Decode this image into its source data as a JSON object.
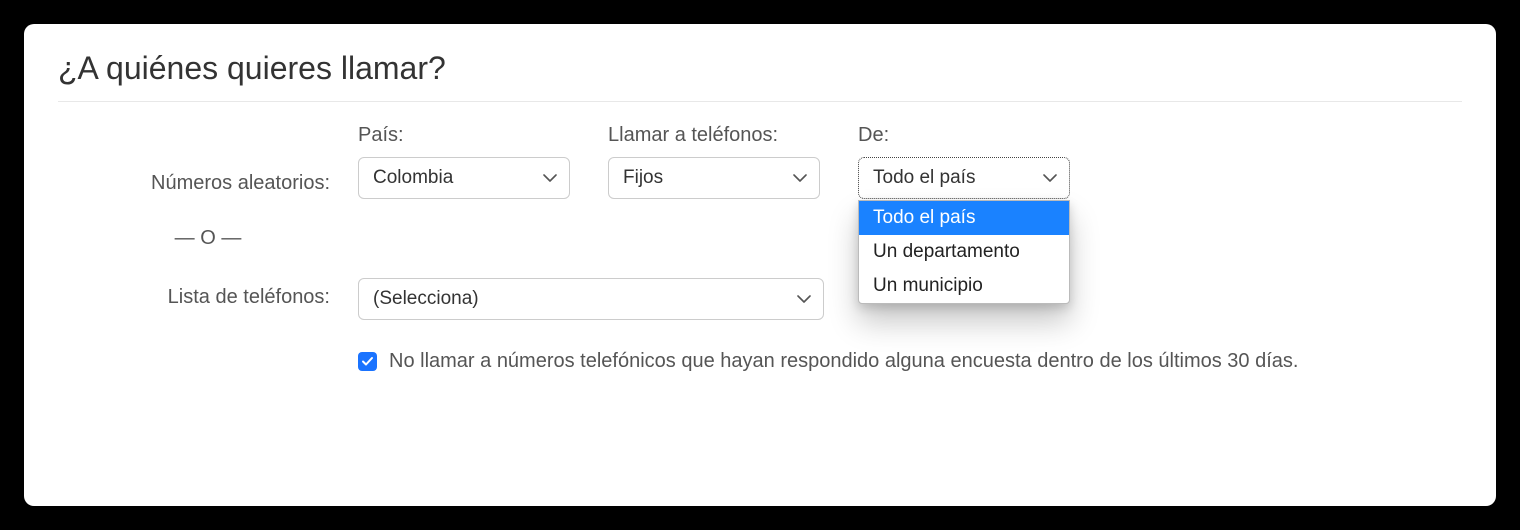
{
  "title": "¿A quiénes quieres llamar?",
  "row_random": {
    "label": "Números aleatorios:",
    "country": {
      "label": "País:",
      "value": "Colombia"
    },
    "phone_type": {
      "label": "Llamar a teléfonos:",
      "value": "Fijos"
    },
    "scope": {
      "label": "De:",
      "value": "Todo el país",
      "options": [
        "Todo el país",
        "Un departamento",
        "Un municipio"
      ]
    }
  },
  "or_separator": "— O —",
  "row_list": {
    "label": "Lista de teléfonos:",
    "placeholder": "(Selecciona)"
  },
  "no_repeat": {
    "checked": true,
    "label": "No llamar a números telefónicos que hayan respondido alguna encuesta dentro de los últimos 30 días."
  }
}
